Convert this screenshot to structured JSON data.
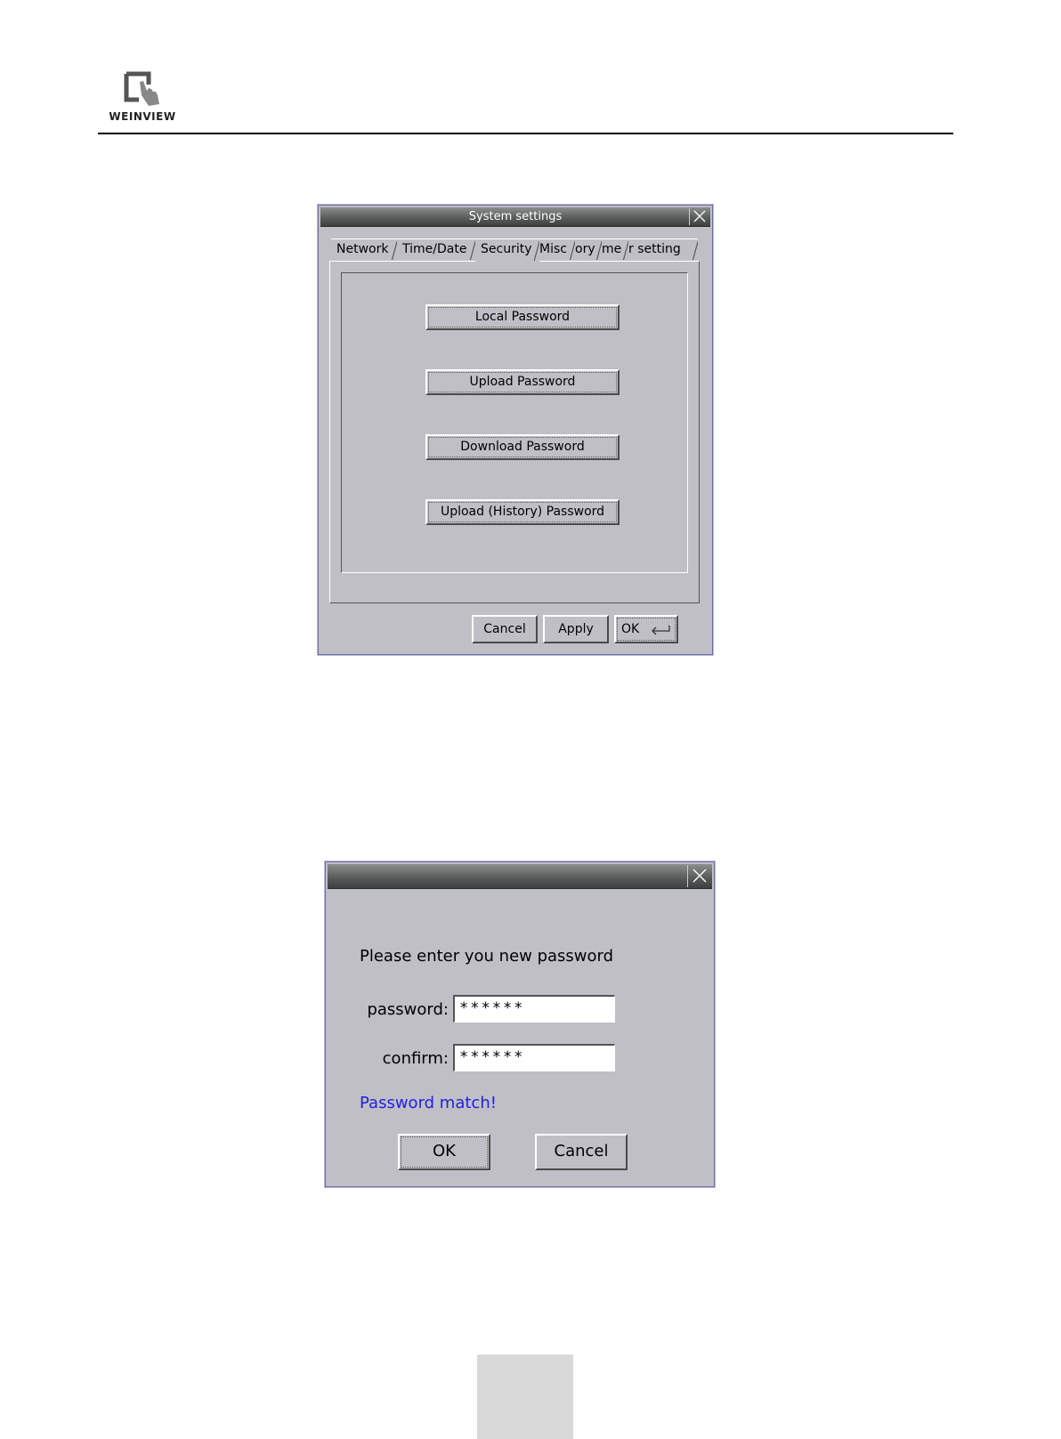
{
  "header": {
    "logo_text": "WEINVIEW"
  },
  "system_settings": {
    "title": "System settings",
    "tabs": [
      {
        "label": "Network"
      },
      {
        "label": "Time/Date"
      },
      {
        "label": "Security",
        "active": true
      },
      {
        "label": "Misc"
      },
      {
        "label": "ory"
      },
      {
        "label": "me"
      },
      {
        "label": "r setting"
      }
    ],
    "buttons": {
      "local_password": "Local Password",
      "upload_password": "Upload Password",
      "download_password": "Download Password",
      "upload_history_password": "Upload (History) Password"
    },
    "footer": {
      "cancel": "Cancel",
      "apply": "Apply",
      "ok": "OK"
    }
  },
  "password_dialog": {
    "prompt": "Please enter you new password",
    "password_label": "password:",
    "password_value": "******",
    "confirm_label": "confirm:",
    "confirm_value": "******",
    "status": "Password match!",
    "status_color": "#1f1fe0",
    "ok": "OK",
    "cancel": "Cancel"
  },
  "icons": {
    "close": "close-icon",
    "enter": "enter-icon",
    "logo": "touch-hand-icon"
  }
}
